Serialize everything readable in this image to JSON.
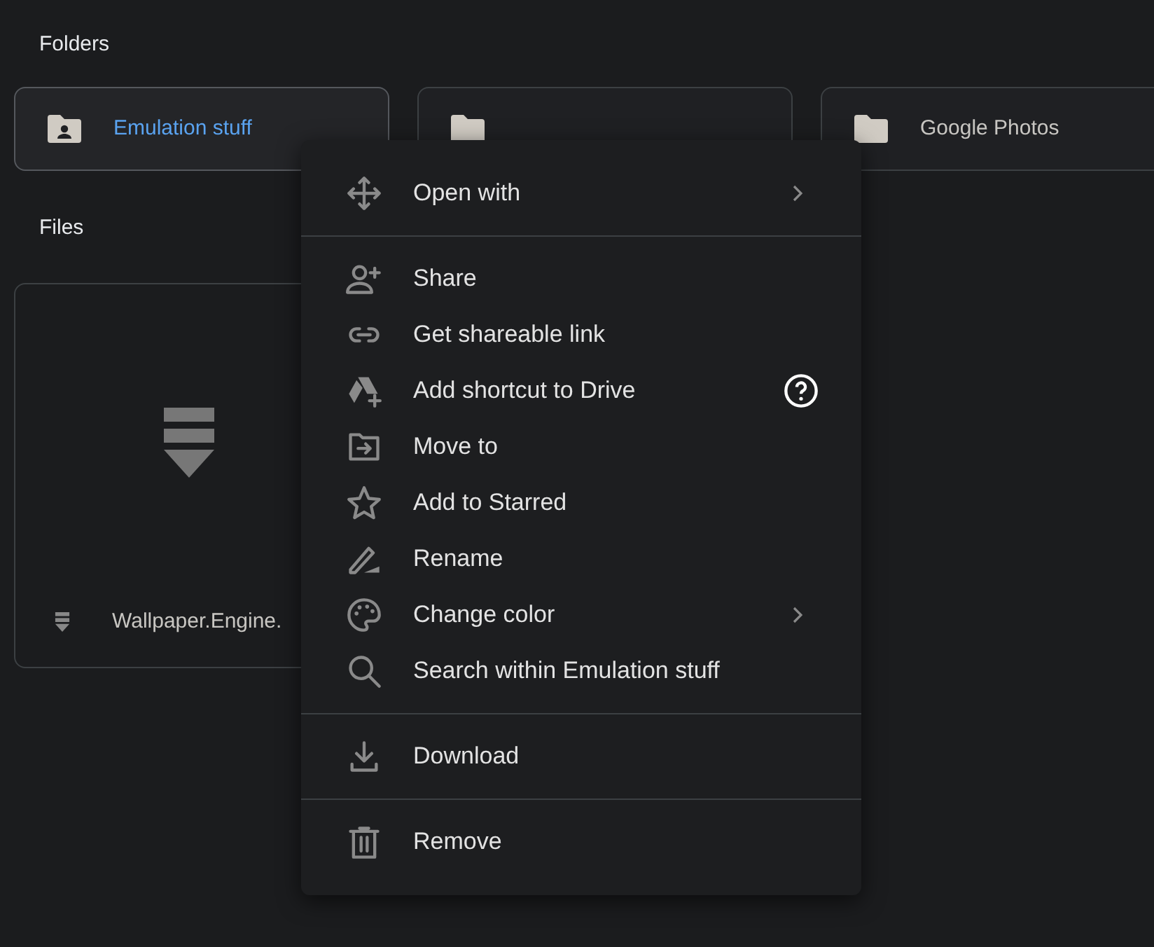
{
  "folders_heading": "Folders",
  "folders": [
    {
      "kind": "shared",
      "name": "Emulation stuff",
      "selected": true
    },
    {
      "kind": "plain",
      "selected": false
    },
    {
      "kind": "plain",
      "name": "Google Photos",
      "selected": false
    }
  ],
  "files_heading": "Files",
  "files": [
    {
      "name": "Wallpaper.Engine."
    }
  ],
  "context_menu": {
    "groups": [
      [
        {
          "label": "Open with",
          "submenu": true,
          "help": false
        }
      ],
      [
        {
          "label": "Share",
          "submenu": false,
          "help": false
        },
        {
          "label": "Get shareable link",
          "submenu": false,
          "help": false
        },
        {
          "label": "Add shortcut to Drive",
          "submenu": false,
          "help": true
        },
        {
          "label": "Move to",
          "submenu": false,
          "help": false
        },
        {
          "label": "Add to Starred",
          "submenu": false,
          "help": false
        },
        {
          "label": "Rename",
          "submenu": false,
          "help": false
        },
        {
          "label": "Change color",
          "submenu": true,
          "help": false
        },
        {
          "label": "Search within Emulation stuff",
          "submenu": false,
          "help": false
        }
      ],
      [
        {
          "label": "Download",
          "submenu": false,
          "help": false
        }
      ],
      [
        {
          "label": "Remove",
          "submenu": false,
          "help": false
        }
      ]
    ]
  }
}
